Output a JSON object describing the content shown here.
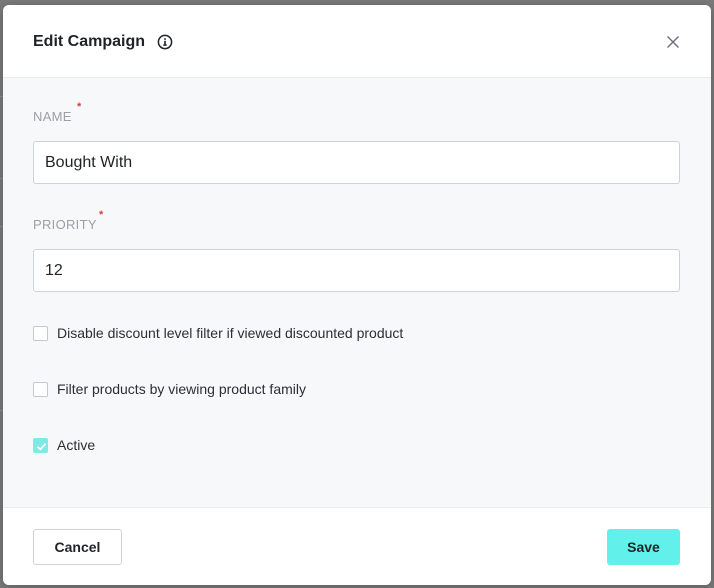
{
  "modal": {
    "title": "Edit Campaign",
    "info_icon": "info-circle-icon",
    "close_icon": "close-icon"
  },
  "form": {
    "name": {
      "label": "NAME",
      "required": "*",
      "value": "Bought With"
    },
    "priority": {
      "label": "PRIORITY",
      "required": "*",
      "value": "12"
    },
    "checkboxes": [
      {
        "label": "Disable discount level filter if viewed discounted product",
        "checked": false
      },
      {
        "label": "Filter products by viewing product family",
        "checked": false
      },
      {
        "label": "Active",
        "checked": true
      }
    ]
  },
  "footer": {
    "cancel_label": "Cancel",
    "save_label": "Save"
  },
  "colors": {
    "accent": "#62f0ea",
    "checkbox_checked": "#7fe9e3",
    "required": "#e23b3b"
  }
}
